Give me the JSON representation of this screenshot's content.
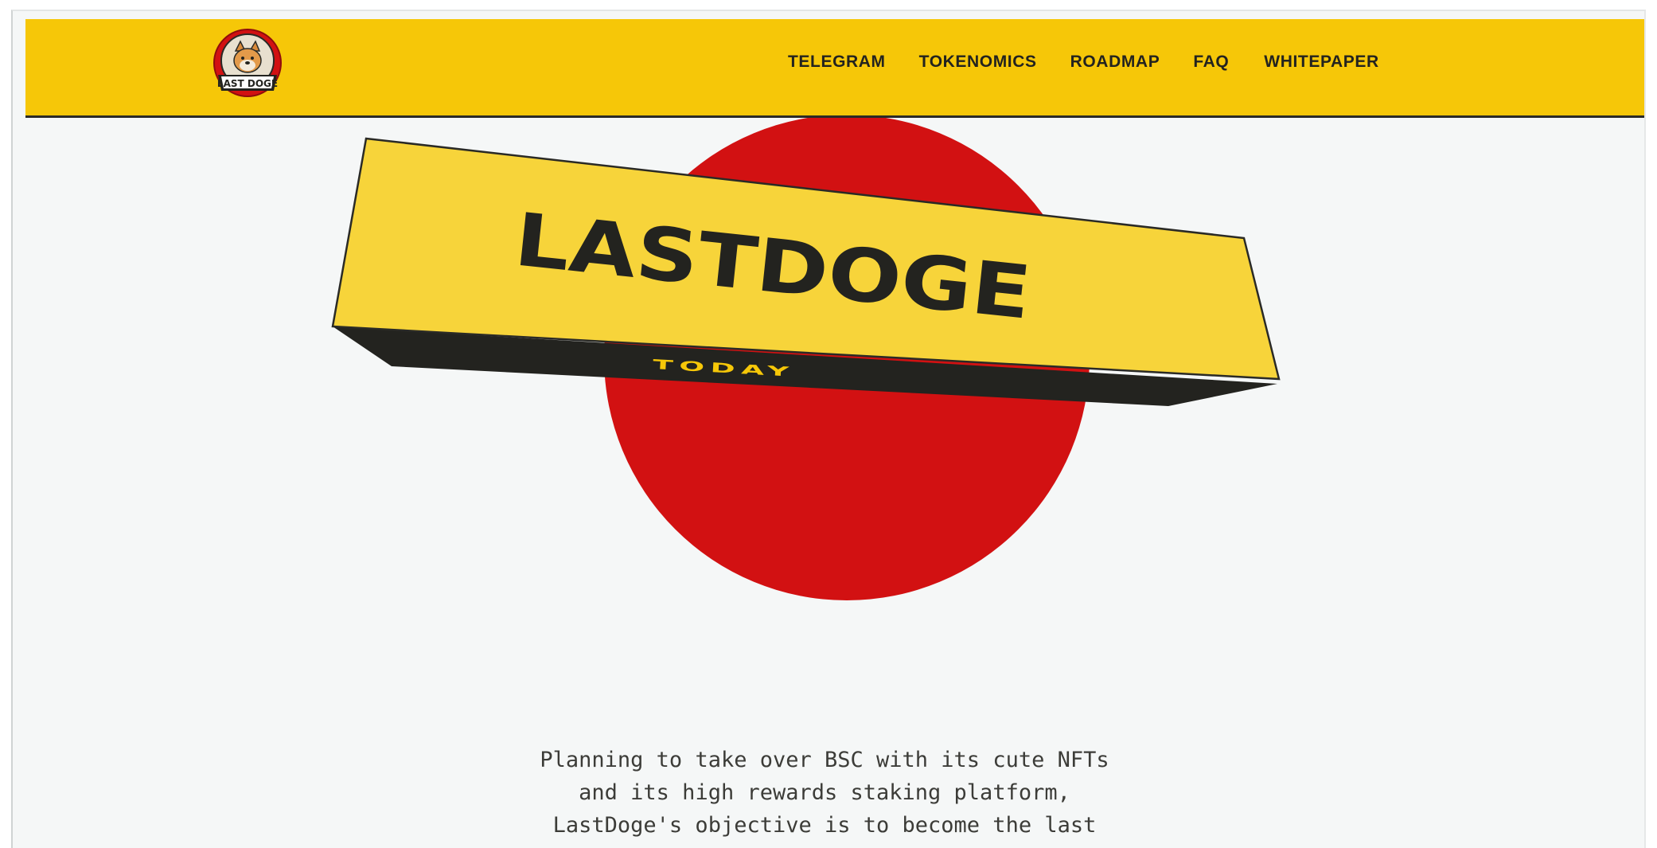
{
  "brand": {
    "logo_text": "LAST DOGE",
    "colors": {
      "yellow": "#f6c708",
      "red": "#d21112",
      "dark": "#23231f",
      "background": "#f5f7f7"
    }
  },
  "nav": {
    "items": [
      {
        "label": "TELEGRAM"
      },
      {
        "label": "TOKENOMICS"
      },
      {
        "label": "ROADMAP"
      },
      {
        "label": "FAQ"
      },
      {
        "label": "WHITEPAPER"
      }
    ]
  },
  "hero": {
    "title": "LASTDOGE",
    "subtitle": "TODAY"
  },
  "intro": {
    "lines": [
      "Planning to take over BSC with its cute NFTs",
      "and its high rewards staking platform,",
      "LastDoge's objective is to become the last"
    ]
  }
}
